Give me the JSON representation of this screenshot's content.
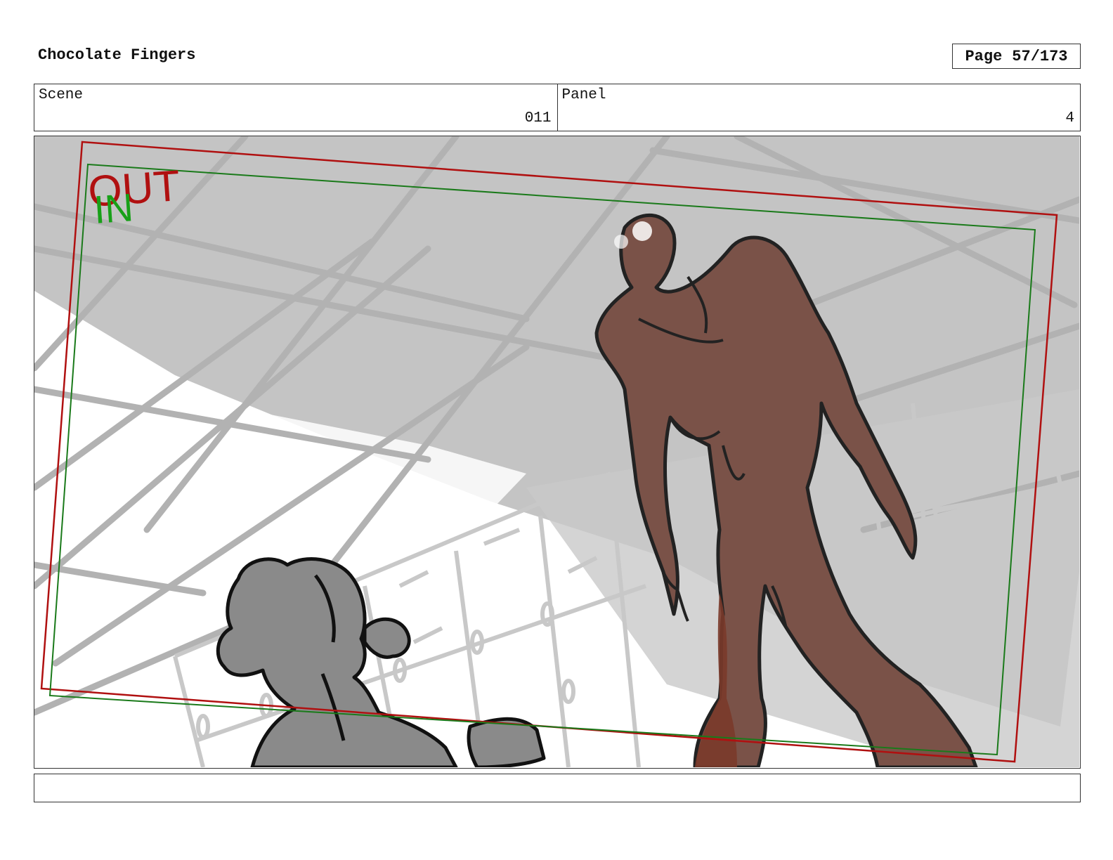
{
  "document": {
    "title": "Chocolate Fingers",
    "page_label": "Page",
    "page_number": "57/173"
  },
  "scene": {
    "label": "Scene",
    "value": "011"
  },
  "panel": {
    "label": "Panel",
    "value": "4"
  },
  "frame_guides": {
    "out_label": "OUT",
    "in_label": "IN",
    "out_color": "#b01010",
    "in_color": "#18a018"
  },
  "colors": {
    "creature": "#7a5248",
    "creature_dark": "#7a3a2a",
    "shadow": "#c4c4c4",
    "girl": "#8a8a8a"
  },
  "caption": {
    "text": ""
  }
}
